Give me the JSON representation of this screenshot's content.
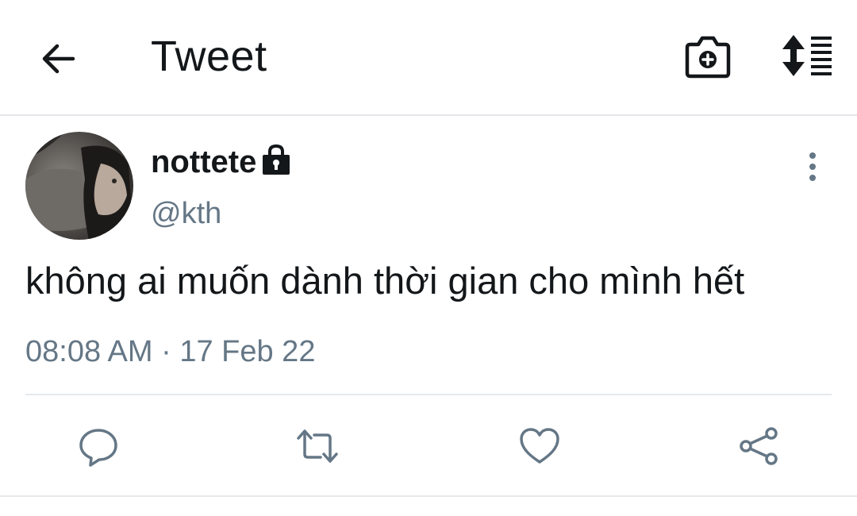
{
  "header": {
    "title": "Tweet",
    "icons": {
      "back": "arrow-left-icon",
      "camera": "camera-plus-icon",
      "sort": "sort-list-icon"
    }
  },
  "tweet": {
    "author": {
      "name": "nottete",
      "handle": "@kth",
      "protected": true
    },
    "text": "không ai muốn dành thời gian cho mình hết",
    "timestamp": "08:08 AM · 17 Feb 22"
  },
  "actions": [
    "reply-icon",
    "retweet-icon",
    "like-icon",
    "share-icon"
  ],
  "colors": {
    "text_primary": "#14171a",
    "text_secondary": "#657786",
    "icon_action": "#657786",
    "divider": "#e6e9ec"
  }
}
